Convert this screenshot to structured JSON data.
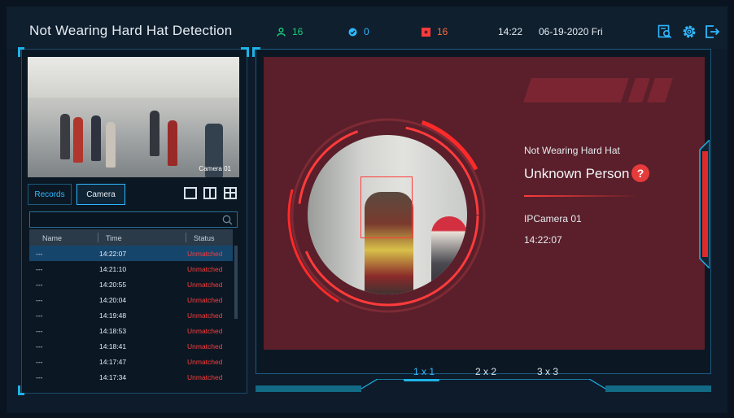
{
  "header": {
    "title": "Not Wearing Hard Hat Detection",
    "people_count": "16",
    "verified_count": "0",
    "alarm_count": "16",
    "time": "14:22",
    "date": "06-19-2020 Fri"
  },
  "colors": {
    "accent": "#1fb3e8",
    "alarm": "#ff3b3b",
    "people": "#19d07a",
    "panel": "#5a1f2a"
  },
  "camera_preview": {
    "label": "Camera 01"
  },
  "tabs": [
    {
      "label": "Records"
    },
    {
      "label": "Camera"
    }
  ],
  "search": {
    "placeholder": ""
  },
  "table": {
    "headers": [
      "Name",
      "Time",
      "Status"
    ],
    "rows": [
      {
        "name": "---",
        "time": "14:22:07",
        "status": "Unmatched"
      },
      {
        "name": "---",
        "time": "14:21:10",
        "status": "Unmatched"
      },
      {
        "name": "---",
        "time": "14:20:55",
        "status": "Unmatched"
      },
      {
        "name": "---",
        "time": "14:20:04",
        "status": "Unmatched"
      },
      {
        "name": "---",
        "time": "14:19:48",
        "status": "Unmatched"
      },
      {
        "name": "---",
        "time": "14:18:53",
        "status": "Unmatched"
      },
      {
        "name": "---",
        "time": "14:18:41",
        "status": "Unmatched"
      },
      {
        "name": "---",
        "time": "14:17:47",
        "status": "Unmatched"
      },
      {
        "name": "---",
        "time": "14:17:34",
        "status": "Unmatched"
      }
    ]
  },
  "detection": {
    "type": "Not Wearing Hard Hat",
    "person": "Unknown Person",
    "help": "?",
    "camera": "IPCamera 01",
    "time": "14:22:07"
  },
  "layouts": [
    "1 x 1",
    "2 x 2",
    "3 x 3"
  ]
}
